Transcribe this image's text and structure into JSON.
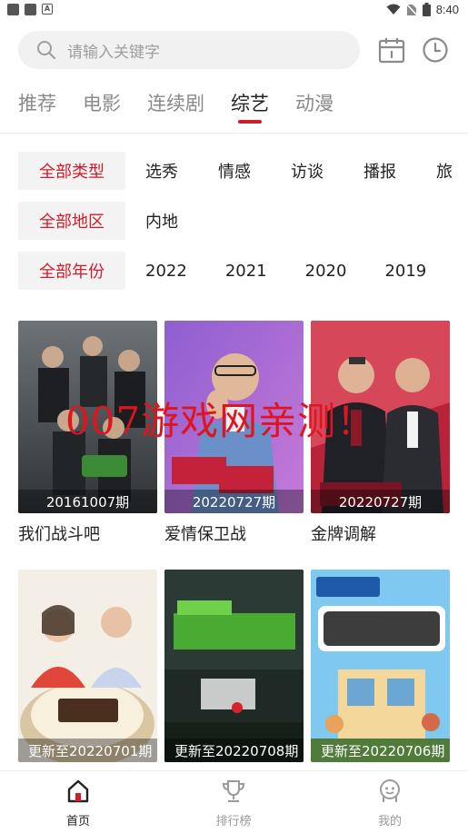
{
  "status_bar": {
    "time": "8:40"
  },
  "header": {
    "search_placeholder": "请输入关键字",
    "icons": [
      "search-icon",
      "calendar-icon",
      "history-clock-icon"
    ]
  },
  "tabs": [
    {
      "label": "推荐",
      "active": false
    },
    {
      "label": "电影",
      "active": false
    },
    {
      "label": "连续剧",
      "active": false
    },
    {
      "label": "综艺",
      "active": true
    },
    {
      "label": "动漫",
      "active": false
    }
  ],
  "filters": {
    "type": {
      "selected": "全部类型",
      "options": [
        "选秀",
        "情感",
        "访谈",
        "播报",
        "旅"
      ]
    },
    "region": {
      "selected": "全部地区",
      "options": [
        "内地"
      ]
    },
    "year": {
      "selected": "全部年份",
      "options": [
        "2022",
        "2021",
        "2020",
        "2019"
      ]
    }
  },
  "shows": [
    {
      "title": "我们战斗吧",
      "episode": "20161007期"
    },
    {
      "title": "爱情保卫战",
      "episode": "20220727期"
    },
    {
      "title": "金牌调解",
      "episode": "20220727期"
    },
    {
      "title": "",
      "episode": "更新至20220701期"
    },
    {
      "title": "",
      "episode": "更新至20220708期"
    },
    {
      "title": "",
      "episode": "更新至20220706期"
    }
  ],
  "watermark": "007游戏网亲测！",
  "bottom_nav": [
    {
      "label": "首页",
      "icon": "home-icon",
      "active": true
    },
    {
      "label": "排行榜",
      "icon": "trophy-icon",
      "active": false
    },
    {
      "label": "我的",
      "icon": "profile-icon",
      "active": false
    }
  ],
  "colors": {
    "accent": "#d01c2a",
    "inactive_text": "#8a8a8a",
    "chip_bg": "#f3f3f3"
  }
}
